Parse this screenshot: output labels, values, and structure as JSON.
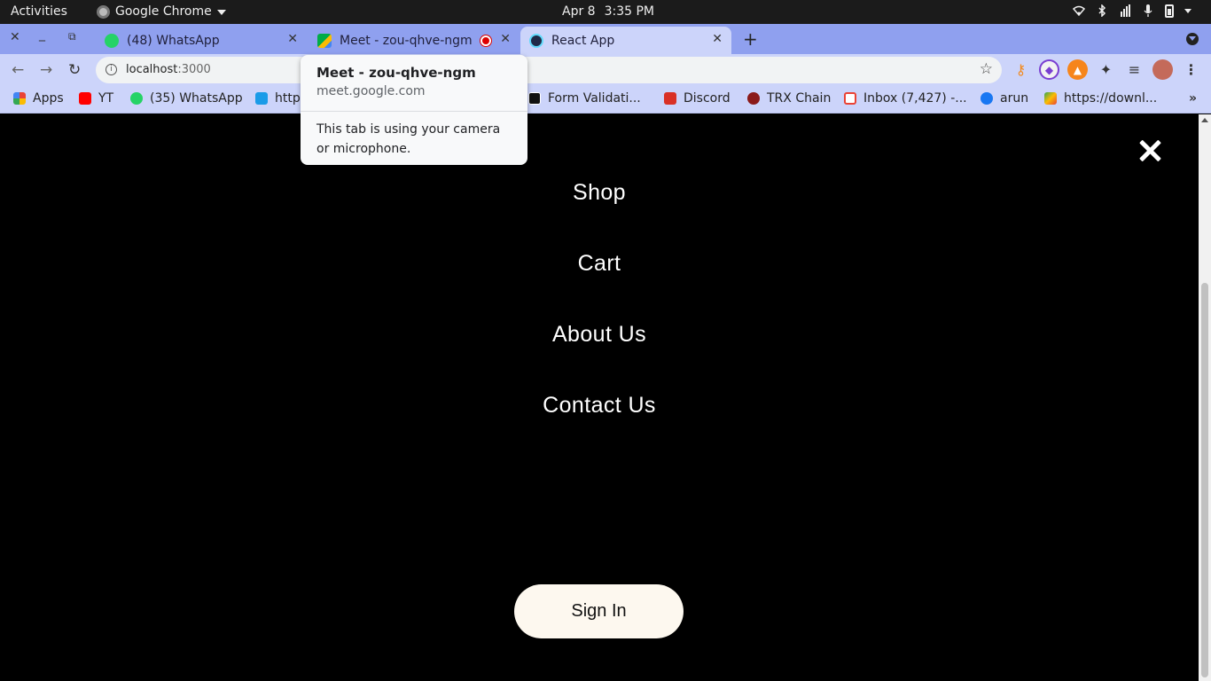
{
  "system_bar": {
    "activities": "Activities",
    "app_name": "Google Chrome",
    "date": "Apr 8",
    "time": "3:35 PM"
  },
  "tabs": [
    {
      "title": "(48) WhatsApp",
      "icon": "whatsapp-icon",
      "color": "#25d366"
    },
    {
      "title": "Meet - zou-qhve-ngm",
      "icon": "google-meet-icon",
      "color": "#00ac47",
      "recording": true
    },
    {
      "title": "React App",
      "icon": "react-icon",
      "color": "#1f2a48",
      "active": true
    }
  ],
  "toolbar": {
    "url_host": "localhost",
    "url_port": ":3000"
  },
  "bookmarks": [
    {
      "label": "Apps",
      "icon": "apps-grid-icon",
      "color": "#ea4335"
    },
    {
      "label": "YT",
      "icon": "youtube-icon",
      "color": "#ff0000"
    },
    {
      "label": "(35) WhatsApp",
      "icon": "whatsapp-icon",
      "color": "#25d366"
    },
    {
      "label": "http",
      "icon": "link-icon",
      "color": "#1a9be8"
    },
    {
      "label": "Form Validati...",
      "icon": "medium-icon",
      "color": "#111111"
    },
    {
      "label": "Discord",
      "icon": "calendar-icon",
      "color": "#d93025"
    },
    {
      "label": "TRX Chain",
      "icon": "tron-icon",
      "color": "#8b1a1a"
    },
    {
      "label": "Inbox (7,427) -...",
      "icon": "gmail-icon",
      "color": "#ea4335"
    },
    {
      "label": "arun",
      "icon": "facebook-icon",
      "color": "#1877f2"
    },
    {
      "label": "https://downl...",
      "icon": "google-play-icon",
      "color": "#34a853"
    }
  ],
  "hover_card": {
    "title": "Meet - zou-qhve-ngm",
    "url": "meet.google.com",
    "message": "This tab is using your camera or microphone."
  },
  "nav_menu": {
    "items": [
      "Shop",
      "Cart",
      "About Us",
      "Contact Us"
    ],
    "sign_in": "Sign In"
  }
}
